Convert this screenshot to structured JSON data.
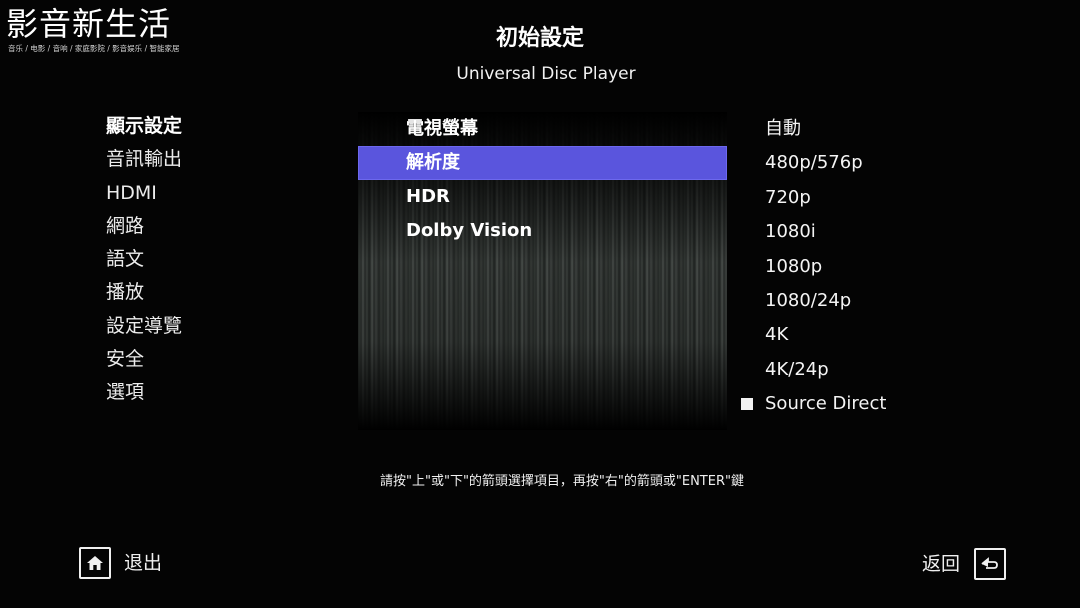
{
  "watermark": {
    "title": "影音新生活",
    "subtitle": "音乐 / 电影 / 音响 / 家庭影院 / 影音娱乐 / 智能家居"
  },
  "header": {
    "title": "初始設定",
    "subtitle": "Universal Disc Player"
  },
  "left_menu": {
    "items": [
      {
        "label": "顯示設定"
      },
      {
        "label": "音訊輸出"
      },
      {
        "label": "HDMI"
      },
      {
        "label": "網路"
      },
      {
        "label": "語文"
      },
      {
        "label": "播放"
      },
      {
        "label": "設定導覽"
      },
      {
        "label": "安全"
      },
      {
        "label": "選項"
      }
    ],
    "active_index": 0
  },
  "middle_menu": {
    "items": [
      {
        "label": "電視螢幕"
      },
      {
        "label": "解析度"
      },
      {
        "label": "HDR"
      },
      {
        "label": "Dolby Vision"
      }
    ],
    "selected_index": 1
  },
  "options": {
    "items": [
      {
        "label": "自動"
      },
      {
        "label": "480p/576p"
      },
      {
        "label": "720p"
      },
      {
        "label": "1080i"
      },
      {
        "label": "1080p"
      },
      {
        "label": "1080/24p"
      },
      {
        "label": "4K"
      },
      {
        "label": "4K/24p"
      },
      {
        "label": "Source Direct"
      }
    ],
    "checkbox_option": "Source Direct"
  },
  "instruction": "請按\"上\"或\"下\"的箭頭選擇項目，再按\"右\"的箭頭或\"ENTER\"鍵",
  "footer": {
    "exit_label": "退出",
    "exit_icon": "home-icon",
    "back_label": "返回",
    "back_icon": "return-icon"
  },
  "colors": {
    "background": "#040404",
    "highlight": "#5a55dd",
    "text": "#ffffff"
  }
}
